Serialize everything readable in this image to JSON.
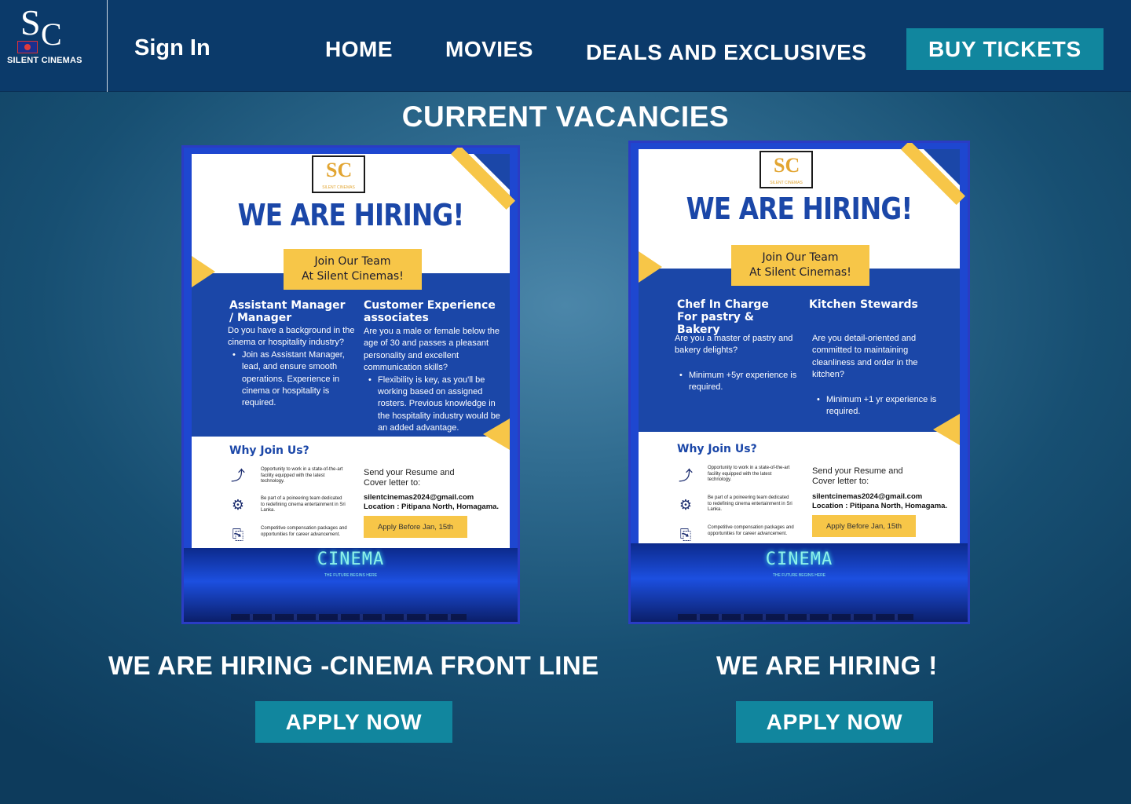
{
  "brand": {
    "mono_s": "S",
    "mono_c": "C",
    "name": "SILENT CINEMAS"
  },
  "nav": {
    "sign_in": "Sign In",
    "home": "HOME",
    "movies": "MOVIES",
    "deals": "DEALS AND EXCLUSIVES",
    "buy_tickets": "BUY TICKETS"
  },
  "page_title": "CURRENT VACANCIES",
  "postings": [
    {
      "caption": "WE ARE HIRING -CINEMA FRONT LINE",
      "apply_label": "APPLY NOW",
      "poster": {
        "logo_mark": "SC",
        "logo_text": "SILENT CINEMAS",
        "headline": "WE ARE HIRING!",
        "join_line1": "Join Our Team",
        "join_line2": "At Silent Cinemas!",
        "col1_title": "Assistant Manager / Manager",
        "col1_intro": "Do you have a background in the cinema or hospitality industry?",
        "col1_bullet": "Join as Assistant Manager, lead, and ensure smooth operations. Experience in cinema or hospitality is required.",
        "col2_title": "Customer Experience associates",
        "col2_intro": "Are you a male or female below the age of 30 and passes a pleasant personality and excellent communication skills?",
        "col2_bullet": "Flexibility is key, as you'll be working based on assigned rosters. Previous knowledge in the hospitality industry would be an added advantage.",
        "why": "Why Join Us?",
        "benefit1": "Opportunity to work in a state-of-the-art facility equipped with the latest technology.",
        "benefit2": "Be part of a poineering team dedicated to redefining cinema entertainment in Sri Lanka.",
        "benefit3": "Competitive compensation packages and opportunities for career advancement.",
        "send": "Send your Resume and Cover letter to:",
        "email": "silentcinemas2024@gmail.com",
        "location": "Location : Pitipana North, Homagama.",
        "apply_before": "Apply Before Jan, 15th",
        "cinema": "CINEMA",
        "cinema_sub": "THE FUTURE BEGINS HERE"
      }
    },
    {
      "caption": "WE ARE HIRING !",
      "apply_label": "APPLY NOW",
      "poster": {
        "logo_mark": "SC",
        "logo_text": "SILENT CINEMAS",
        "headline": "WE ARE HIRING!",
        "join_line1": "Join Our Team",
        "join_line2": "At Silent Cinemas!",
        "col1_title": "Chef In Charge For pastry & Bakery",
        "col1_intro": "Are you a master of pastry and bakery delights?",
        "col1_bullet": "Minimum +5yr experience is required.",
        "col2_title": "Kitchen Stewards",
        "col2_intro": "Are you detail-oriented and committed to maintaining cleanliness and order in the kitchen?",
        "col2_bullet": "Minimum +1 yr experience is required.",
        "why": "Why Join Us?",
        "benefit1": "Opportunity to work in a state-of-the-art facility equipped with the latest technology.",
        "benefit2": "Be part of a poineering team dedicated to redefining cinema entertainment in Sri Lanka.",
        "benefit3": "Competitive compensation packages and opportunities for career advancement.",
        "send": "Send your Resume and Cover letter to:",
        "email": "silentcinemas2024@gmail.com",
        "location": "Location : Pitipana North, Homagama.",
        "apply_before": "Apply Before Jan, 15th",
        "cinema": "CINEMA",
        "cinema_sub": "THE FUTURE BEGINS HERE"
      }
    }
  ],
  "colors": {
    "nav_bg": "#0b3a6a",
    "button_bg": "#11869e",
    "poster_blue": "#1b47a8",
    "poster_yellow": "#f7c648"
  }
}
